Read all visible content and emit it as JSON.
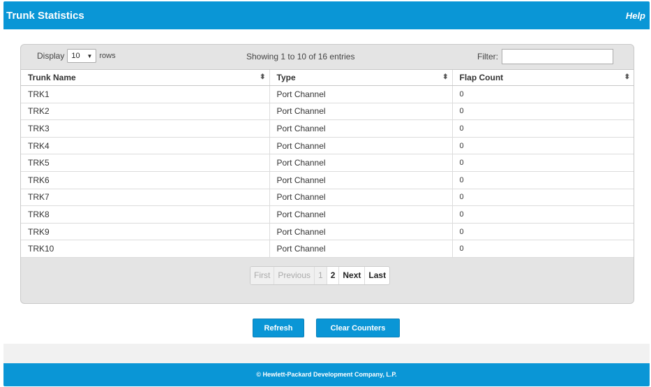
{
  "header": {
    "title": "Trunk Statistics",
    "help_label": "Help"
  },
  "toolbar": {
    "display_label": "Display",
    "display_value": "10",
    "rows_label": "rows",
    "showing_text": "Showing 1 to 10 of 16 entries",
    "filter_label": "Filter:",
    "filter_value": ""
  },
  "table": {
    "columns": [
      "Trunk Name",
      "Type",
      "Flap Count"
    ],
    "rows": [
      [
        "TRK1",
        "Port Channel",
        "0"
      ],
      [
        "TRK2",
        "Port Channel",
        "0"
      ],
      [
        "TRK3",
        "Port Channel",
        "0"
      ],
      [
        "TRK4",
        "Port Channel",
        "0"
      ],
      [
        "TRK5",
        "Port Channel",
        "0"
      ],
      [
        "TRK6",
        "Port Channel",
        "0"
      ],
      [
        "TRK7",
        "Port Channel",
        "0"
      ],
      [
        "TRK8",
        "Port Channel",
        "0"
      ],
      [
        "TRK9",
        "Port Channel",
        "0"
      ],
      [
        "TRK10",
        "Port Channel",
        "0"
      ]
    ]
  },
  "pagination": {
    "first": "First",
    "previous": "Previous",
    "page1": "1",
    "page2": "2",
    "next": "Next",
    "last": "Last"
  },
  "buttons": {
    "refresh": "Refresh",
    "clear_counters": "Clear Counters"
  },
  "footer": {
    "copyright": "© Hewlett-Packard Development Company, L.P."
  },
  "colors": {
    "brand": "#0a96d6"
  }
}
